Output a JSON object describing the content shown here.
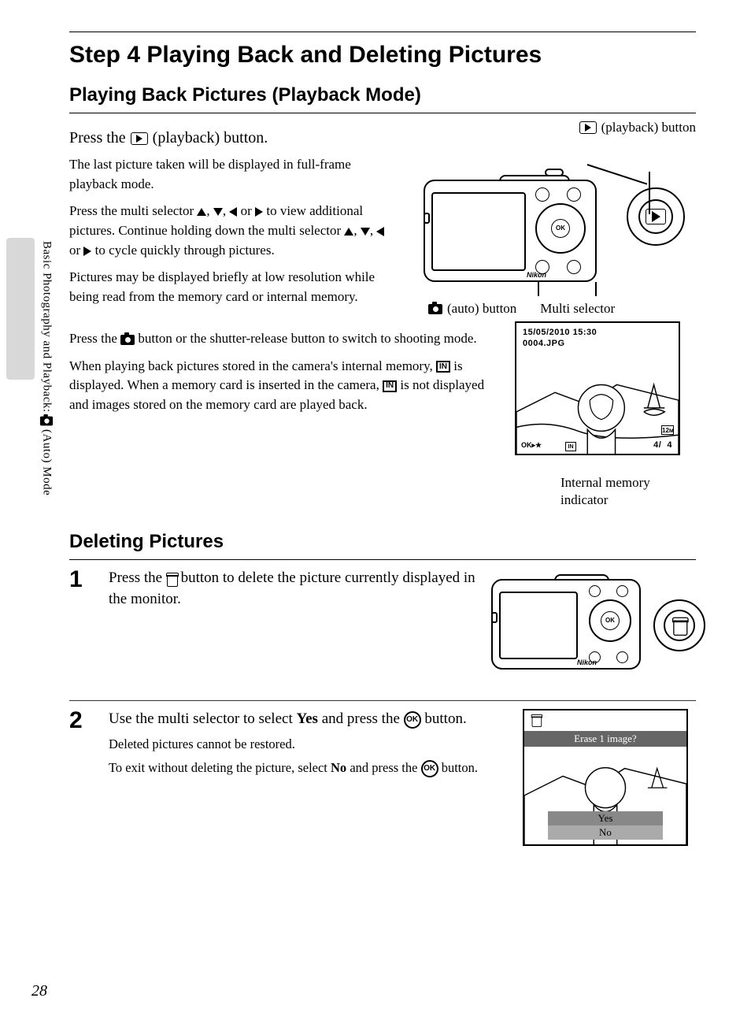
{
  "sidebar_text_before": "Basic Photography and Playback:",
  "sidebar_text_after": "(Auto) Mode",
  "page_number": "28",
  "step_title": "Step 4 Playing Back and Deleting Pictures",
  "section1_title": "Playing Back Pictures (Playback Mode)",
  "press_playback_text_a": "Press the",
  "press_playback_text_b": "(playback) button.",
  "para1": "The last picture taken will be displayed in full-frame playback mode.",
  "para2a": "Press the multi selector ",
  "para2b": " to view additional pictures. Continue holding down the multi selector ",
  "para2c": " to cycle quickly through pictures.",
  "para3": "Pictures may be displayed briefly at low resolution while being read from the memory card or internal memory.",
  "para4a": "Press the ",
  "para4b": " button or the shutter-release button to switch to shooting mode.",
  "para5a": "When playing back pictures stored in the camera's internal memory, ",
  "para5b": " is displayed. When a memory card is inserted in the camera, ",
  "para5c": " is not displayed and images stored on the memory card are played back.",
  "label_playback_button": "(playback) button",
  "label_auto_button": "(auto) button",
  "label_multi_selector": "Multi selector",
  "label_internal_memory": "Internal memory indicator",
  "cam_brand": "Nikon",
  "preview_date": "15/05/2010 15:30",
  "preview_file": "0004.JPG",
  "preview_count_current": "4",
  "preview_count_sep": "/",
  "preview_count_total": "4",
  "section2_title": "Deleting Pictures",
  "step1_num": "1",
  "step1_text_a": "Press the ",
  "step1_text_b": " button to delete the picture currently displayed in the monitor.",
  "step2_num": "2",
  "step2_text_a": "Use the multi selector to select ",
  "step2_text_bold1": "Yes",
  "step2_text_b": " and press the ",
  "step2_text_c": " button.",
  "step2_sub1": "Deleted pictures cannot be restored.",
  "step2_sub2a": "To exit without deleting the picture, select ",
  "step2_sub2_bold": "No",
  "step2_sub2b": " and press the ",
  "step2_sub2c": " button.",
  "erase_prompt": "Erase 1 image?",
  "erase_yes": "Yes",
  "erase_no": "No",
  "or_text": " or ",
  "comma": ", "
}
